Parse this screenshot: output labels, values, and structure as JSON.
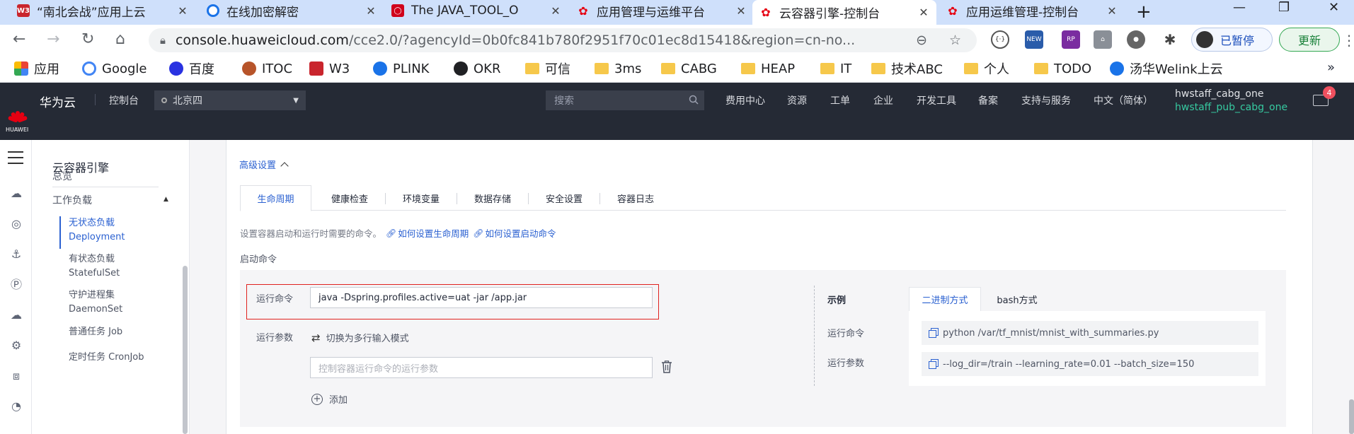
{
  "browser": {
    "tabs": [
      {
        "title": "“南北会战”应用上云",
        "icon": "w3-icon"
      },
      {
        "title": "在线加密解密",
        "icon": "crypto-c-icon"
      },
      {
        "title": "The JAVA_TOOL_O",
        "icon": "oracle-icon"
      },
      {
        "title": "应用管理与运维平台",
        "icon": "huawei-icon"
      },
      {
        "title": "云容器引擎-控制台",
        "icon": "huawei-icon",
        "active": true
      },
      {
        "title": "应用运维管理-控制台",
        "icon": "huawei-icon"
      }
    ],
    "address": {
      "host": "console.huaweicloud.com",
      "path": "/cce2.0/?agencyId=0b0fc841b780f2951f70c01ec8d15418&region=cn-no..."
    },
    "profile_label": "已暂停",
    "update_label": "更新",
    "bookmarks": [
      "应用",
      "Google",
      "百度",
      "ITOC",
      "W3",
      "PLINK",
      "OKR",
      "可信",
      "3ms",
      "CABG",
      "HEAP",
      "IT",
      "技术ABC",
      "个人",
      "TODO",
      "汤华Welink上云"
    ]
  },
  "header": {
    "logo_text": "HUAWEI",
    "brand": "华为云",
    "console": "控制台",
    "region": "北京四",
    "search_placeholder": "搜索",
    "nav": [
      "费用中心",
      "资源",
      "工单",
      "企业",
      "开发工具",
      "备案",
      "支持与服务",
      "中文（简体）"
    ],
    "user": "hwstaff_cabg_one",
    "sub_user": "hwstaff_pub_cabg_one",
    "mail_count": "4",
    "accent": "#36c9a0"
  },
  "sidebar": {
    "title": "云容器引擎",
    "items": [
      "总览",
      "工作负载"
    ],
    "sub_items": [
      {
        "cn": "无状态负载",
        "en": "Deployment",
        "active": true
      },
      {
        "cn": "有状态负载",
        "en": "StatefulSet"
      },
      {
        "cn": "守护进程集",
        "en": "DaemonSet"
      },
      {
        "cn": "普通任务 Job",
        "en": ""
      },
      {
        "cn": "定时任务 CronJob",
        "en": ""
      }
    ]
  },
  "main": {
    "advanced_label": "高级设置",
    "tabs": [
      "生命周期",
      "健康检查",
      "环境变量",
      "数据存储",
      "安全设置",
      "容器日志"
    ],
    "description": "设置容器启动和运行时需要的命令。",
    "link1": "如何设置生命周期",
    "link2": "如何设置启动命令",
    "start_cmd_label": "启动命令",
    "run_cmd_label": "运行命令",
    "run_cmd_value": "java -Dspring.profiles.active=uat -jar /app.jar",
    "run_args_label": "运行参数",
    "switch_label": "切换为多行输入模式",
    "args_placeholder": "控制容器运行命令的运行参数",
    "add_label": "添加",
    "example": {
      "title": "示例",
      "tabs": [
        "二进制方式",
        "bash方式"
      ],
      "cmd_label": "运行命令",
      "cmd_value": "python /var/tf_mnist/mnist_with_summaries.py",
      "args_label": "运行参数",
      "args_value": "--log_dir=/train --learning_rate=0.01 --batch_size=150"
    }
  }
}
